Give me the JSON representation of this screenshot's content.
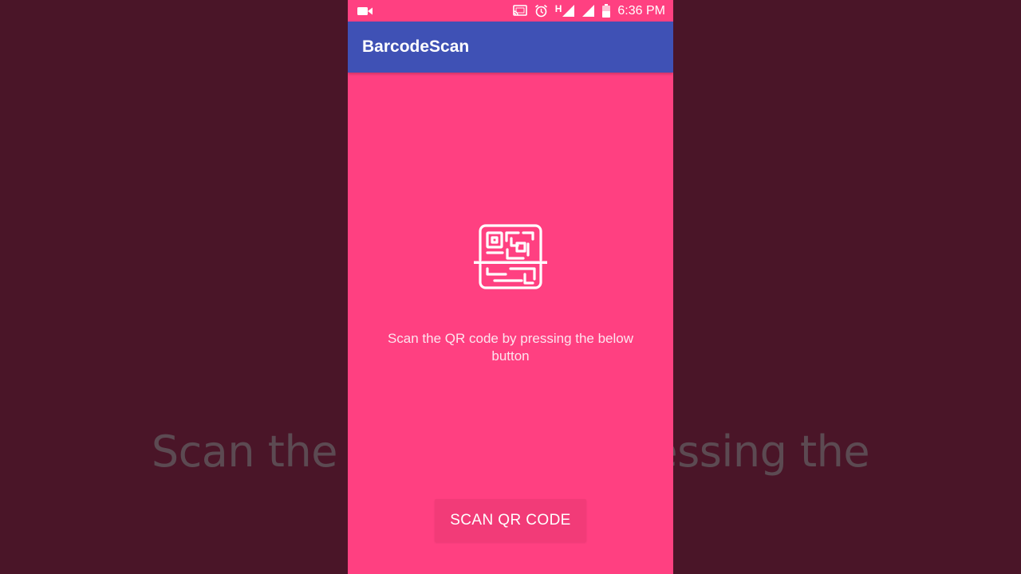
{
  "backdrop": {
    "caption": "Scan the QR code by pressing the"
  },
  "status_bar": {
    "time": "6:36 PM",
    "network_type": "H",
    "icons": [
      "video-camera-icon",
      "cast-icon",
      "alarm-icon",
      "signal-icon",
      "signal-icon",
      "battery-icon"
    ]
  },
  "app_bar": {
    "title": "BarcodeScan"
  },
  "main": {
    "icon": "qr-code-scan-icon",
    "instruction": "Scan the QR code by pressing the below button",
    "scan_button_label": "SCAN QR CODE"
  },
  "colors": {
    "background": "#ff4081",
    "app_bar": "#3f51b5",
    "backdrop": "#4a1528",
    "button": "#f23b78"
  }
}
